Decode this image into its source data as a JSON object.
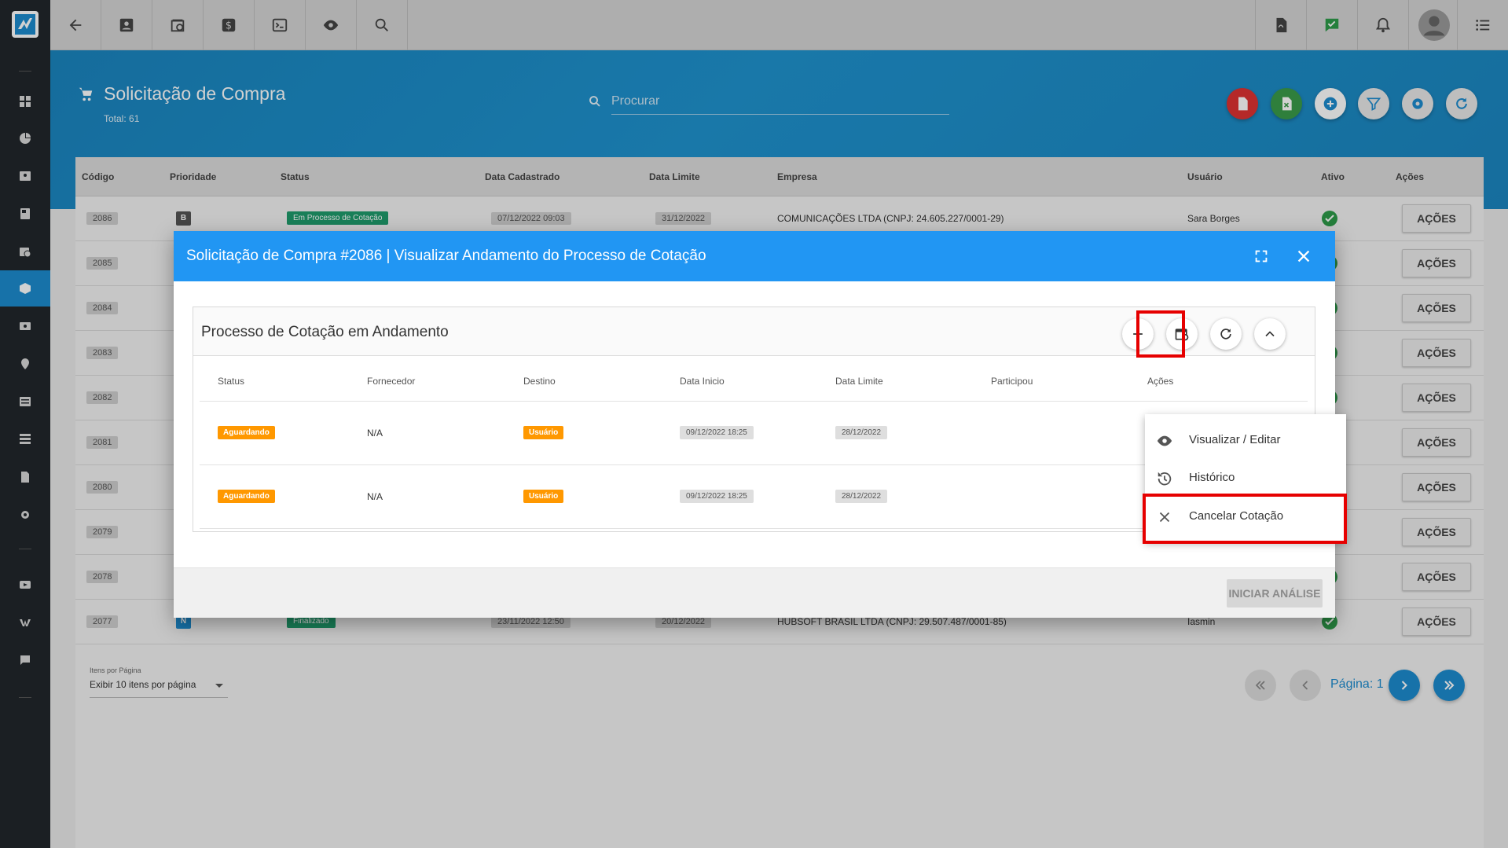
{
  "topbar": {
    "left_icons": [
      "back-arrow-icon",
      "contact-card-icon",
      "calendar-clock-icon",
      "dollar-icon",
      "terminal-icon",
      "eye-icon",
      "search-icon"
    ],
    "right_icons": [
      "pdf-file-icon",
      "chat-check-icon",
      "bell-icon",
      "avatar",
      "list-menu-icon"
    ]
  },
  "header": {
    "title": "Solicitação de Compra",
    "total": "Total: 61",
    "search_placeholder": "Procurar"
  },
  "table": {
    "columns": [
      "Código",
      "Prioridade",
      "Status",
      "Data Cadastrado",
      "Data Limite",
      "Empresa",
      "Usuário",
      "Ativo",
      "Ações"
    ],
    "rows": [
      {
        "code": "2086",
        "priority": "B",
        "status": "Em Processo de Cotação",
        "created": "07/12/2022 09:03",
        "limit": "31/12/2022",
        "company": "COMUNICAÇÕES LTDA (CNPJ: 24.605.227/0001-29)",
        "user": "Sara Borges",
        "action": "AÇÕES"
      },
      {
        "code": "2085",
        "action": "AÇÕES"
      },
      {
        "code": "2084",
        "action": "AÇÕES"
      },
      {
        "code": "2083",
        "action": "AÇÕES"
      },
      {
        "code": "2082",
        "action": "AÇÕES"
      },
      {
        "code": "2081",
        "action": "AÇÕES"
      },
      {
        "code": "2080",
        "action": "AÇÕES"
      },
      {
        "code": "2079",
        "action": "AÇÕES"
      },
      {
        "code": "2078",
        "action": "AÇÕES"
      },
      {
        "code": "2077",
        "priority": "N",
        "status": "Finalizado",
        "created": "23/11/2022 12:50",
        "limit": "20/12/2022",
        "company": "HUBSOFT BRASIL LTDA (CNPJ: 29.507.487/0001-85)",
        "user": "Iasmin",
        "action": "AÇÕES"
      }
    ]
  },
  "pagination": {
    "items_label": "Itens por Página",
    "items_value": "Exibir 10 itens por página",
    "page_label": "Página: 1"
  },
  "modal": {
    "title": "Solicitação de Compra #2086 | Visualizar Andamento do Processo de Cotação",
    "panel_title": "Processo de Cotação em Andamento",
    "columns": [
      "Status",
      "Fornecedor",
      "Destino",
      "Data Inicio",
      "Data Limite",
      "Participou",
      "Ações"
    ],
    "rows": [
      {
        "status": "Aguardando",
        "supplier": "N/A",
        "destination": "Usuário",
        "start": "09/12/2022 18:25",
        "limit": "28/12/2022"
      },
      {
        "status": "Aguardando",
        "supplier": "N/A",
        "destination": "Usuário",
        "start": "09/12/2022 18:25",
        "limit": "28/12/2022"
      }
    ],
    "footer_button": "INICIAR ANÁLISE"
  },
  "menu": {
    "items": [
      "Visualizar / Editar",
      "Histórico",
      "Cancelar Cotação"
    ]
  },
  "colors": {
    "primary_blue": "#2196f3",
    "header_blue": "#1f93cf",
    "highlight_red": "#e60000",
    "warning_orange": "#ff9800",
    "success_green": "#2e9b4a"
  }
}
